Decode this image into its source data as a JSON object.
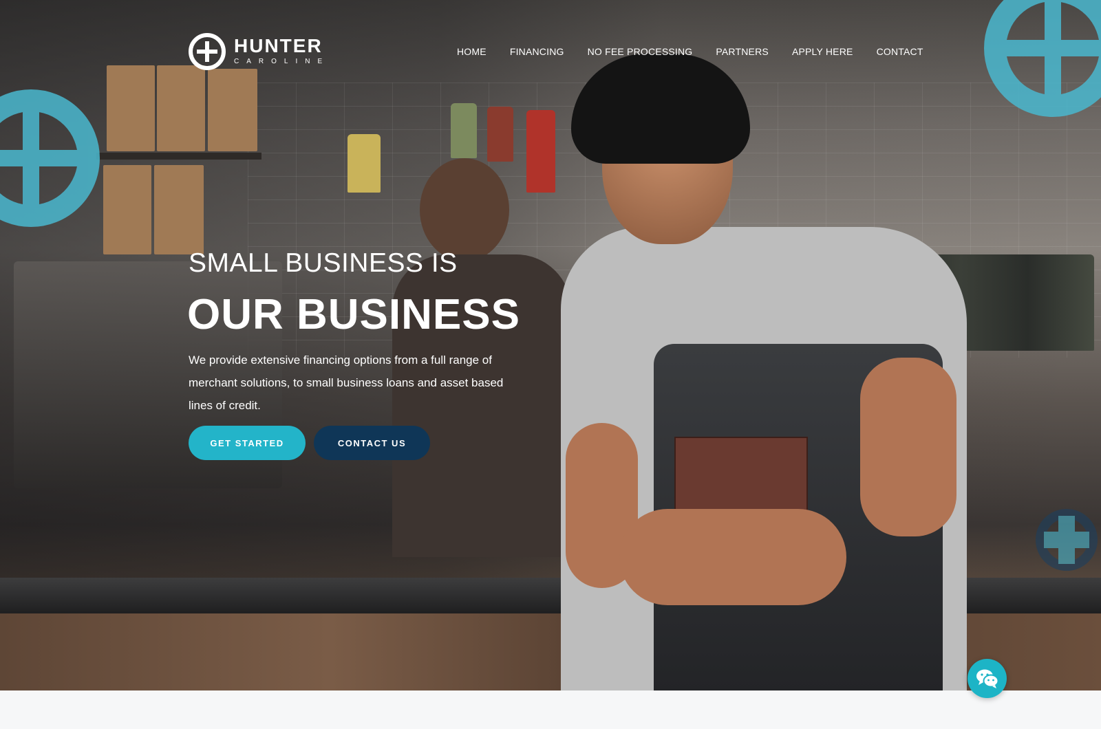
{
  "brand": {
    "name": "HUNTER",
    "sub": "CAROLINE",
    "logo_icon": "hunter-caroline-emblem",
    "accent_color": "#23b4c9",
    "dark_color": "#0f3657"
  },
  "nav": {
    "items": [
      {
        "label": "HOME"
      },
      {
        "label": "FINANCING"
      },
      {
        "label": "NO FEE PROCESSING"
      },
      {
        "label": "PARTNERS"
      },
      {
        "label": "APPLY HERE"
      },
      {
        "label": "CONTACT"
      }
    ]
  },
  "hero": {
    "kicker": "SMALL BUSINESS IS",
    "headline": "OUR BUSINESS",
    "description": "We provide extensive financing options from a full range of merchant solutions, to small business loans and asset based lines of credit.",
    "primary_button": "GET STARTED",
    "secondary_button": "CONTACT US"
  },
  "chat": {
    "icon": "wechat-icon"
  }
}
